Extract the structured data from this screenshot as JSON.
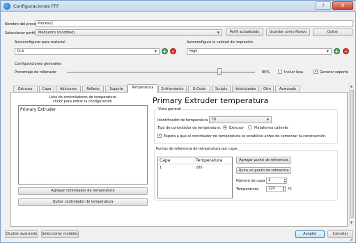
{
  "window": {
    "title": "Configuraciones FFF",
    "help_glyph": "?",
    "close_glyph": "X"
  },
  "process": {
    "name_label": "Nombre del proceso:",
    "name_value": "Process2"
  },
  "profile": {
    "label": "Seleccionar perfil:",
    "selected": "Mediumto (modified)",
    "buttons": {
      "update": "Perfil actualizado",
      "save_new": "Guardar como Nuevo",
      "remove": "Quitar"
    }
  },
  "autoconfig": {
    "material_label": "Autoconfigurar para material",
    "material_value": "PLA",
    "quality_label": "Autoconfigura la calidad de impresión",
    "quality_value": "High",
    "plus": "+",
    "minus": "–"
  },
  "general": {
    "section_label": "Configuraciones generales",
    "infill_label": "Porcentaje de rellenado:",
    "infill_value": "80%",
    "infill_fraction": 0.8,
    "include_raft": "Incluir losa",
    "include_raft_checked": false,
    "generate_support": "Generar soporte",
    "generate_support_checked": true
  },
  "tabs": [
    {
      "label": "Extrusor"
    },
    {
      "label": "Capa"
    },
    {
      "label": "Adiciones"
    },
    {
      "label": "Relleno"
    },
    {
      "label": "Soporte"
    },
    {
      "label": "Temperatura"
    },
    {
      "label": "Enfriamiento"
    },
    {
      "label": "G-Code"
    },
    {
      "label": "Scripts"
    },
    {
      "label": "Velocidades"
    },
    {
      "label": "Otro"
    },
    {
      "label": "Avanzado"
    }
  ],
  "temperature": {
    "list_header_line1": "Lista de controladores de temperatura",
    "list_header_line2": "clickz para editar la configuración",
    "controllers": [
      "Primary Extruder"
    ],
    "add_controller": "Agregar controlador de temperatura",
    "remove_controller": "Quitar controlador de temperatura",
    "heading": "Primary Extruder temperatura",
    "overview_label": "Vista general",
    "identifier_label": "Identificador de temperatura",
    "identifier_value": "T0",
    "controller_type_label": "Tipo de controlador de temperatura:",
    "type_extruder": "Extrusor",
    "type_bed": "Plataforma caliente",
    "selected_type": "Extrusor",
    "wait_label": "Espera a que el controlador de temperatura se estabilice antes de comenzar la construcción.",
    "wait_checked": true,
    "setpoints_label": "Puntos de referencia de temperatura por capa",
    "table_headers": [
      "Capa",
      "Temperatura"
    ],
    "table_rows": [
      [
        "1",
        "200"
      ]
    ],
    "add_setpoint": "Agregar punto de referencia",
    "remove_setpoint": "Quita un punto de referencia",
    "layer_number_label": "Número de capa",
    "layer_number_value": "1",
    "temperature_label": "Temperatura",
    "temperature_value": "220",
    "temperature_unit": "ºC"
  },
  "footer": {
    "hide_advanced": "Ocultar avanzado",
    "select_models": "Seleccionar modelos",
    "accept": "Aceptar",
    "cancel": "Cancelar"
  }
}
